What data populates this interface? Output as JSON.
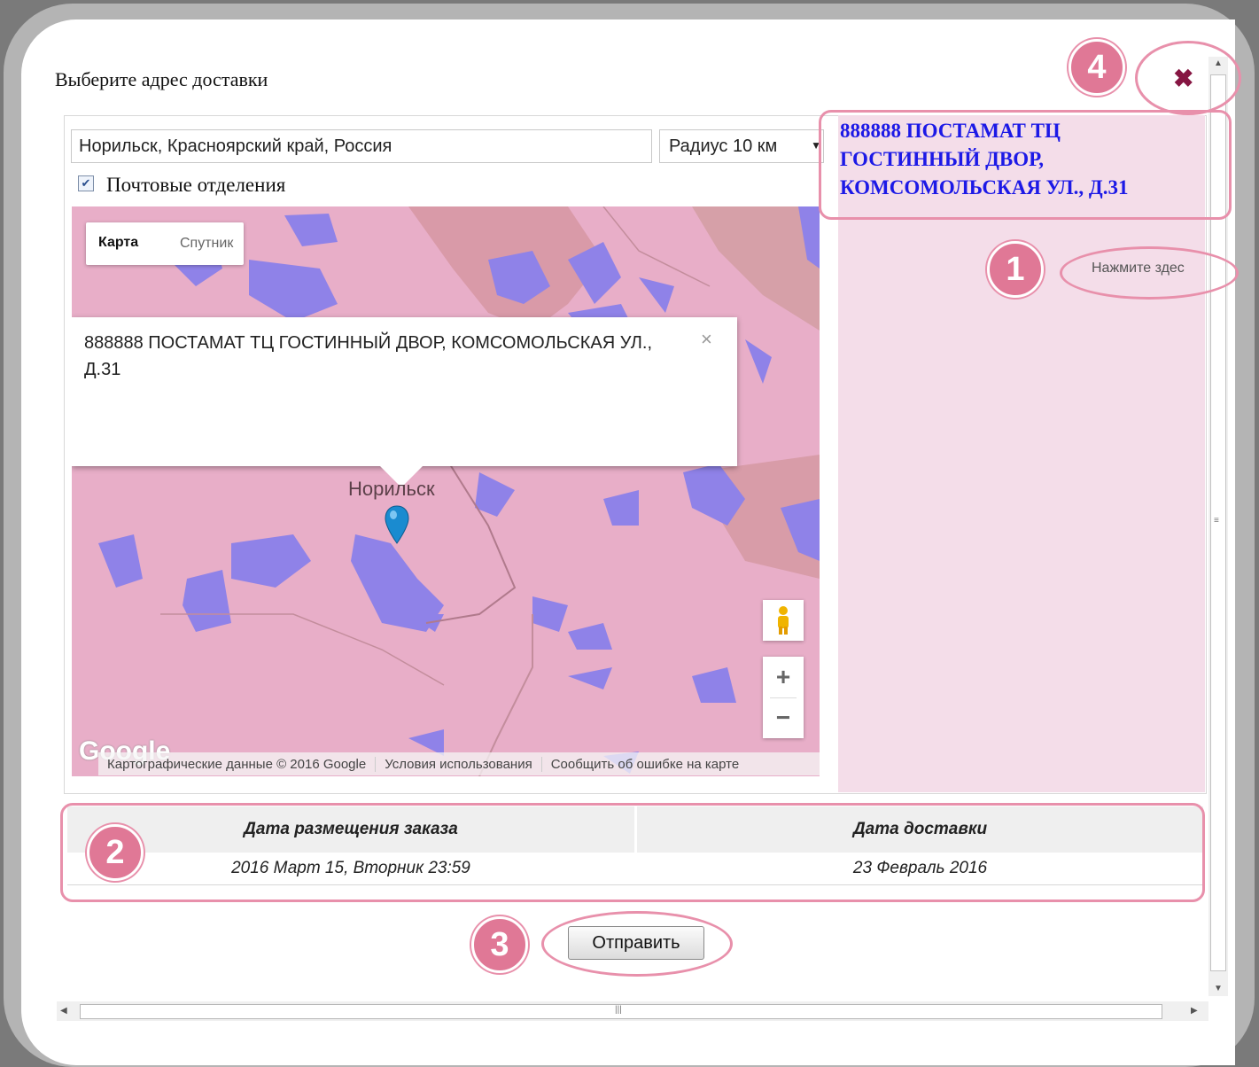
{
  "dialog": {
    "title": "Выберите адрес доставки",
    "close_icon": "close-icon"
  },
  "search": {
    "address_value": "Норильск, Красноярский край, Россия",
    "radius_selected": "Радиус 10 км",
    "post_offices_checked": true,
    "post_offices_label": "Почтовые отделения"
  },
  "map": {
    "type_map": "Карта",
    "type_satellite": "Спутник",
    "info_window_text": "888888 ПОСТАМАТ ТЦ ГОСТИННЫЙ ДВОР, КОМСОМОЛЬСКАЯ УЛ., Д.31",
    "info_close": "×",
    "city_label": "Норильск",
    "zoom_in": "+",
    "zoom_out": "−",
    "logo": "Google",
    "attribution": [
      "Картографические данные © 2016 Google",
      "Условия использования",
      "Сообщить об ошибке на карте"
    ]
  },
  "side": {
    "selected_title": "888888 ПОСТАМАТ ТЦ ГОСТИННЫЙ ДВОР, КОМСОМОЛЬСКАЯ УЛ., Д.31",
    "hint": "Нажмите здес"
  },
  "dates": {
    "header_order": "Дата размещения заказа",
    "header_delivery": "Дата доставки",
    "order_value": "2016 Март 15, Вторник 23:59",
    "delivery_value": "23 Февраль 2016"
  },
  "actions": {
    "submit_label": "Отправить"
  },
  "annotations": {
    "badge_1": "1",
    "badge_2": "2",
    "badge_3": "3",
    "badge_4": "4"
  },
  "colors": {
    "accent_badge": "#e07896",
    "ring": "#e890ab",
    "link_title": "#1c19e6",
    "close": "#861542",
    "map_land": "#e8aec8",
    "map_water": "#8f82e8"
  }
}
